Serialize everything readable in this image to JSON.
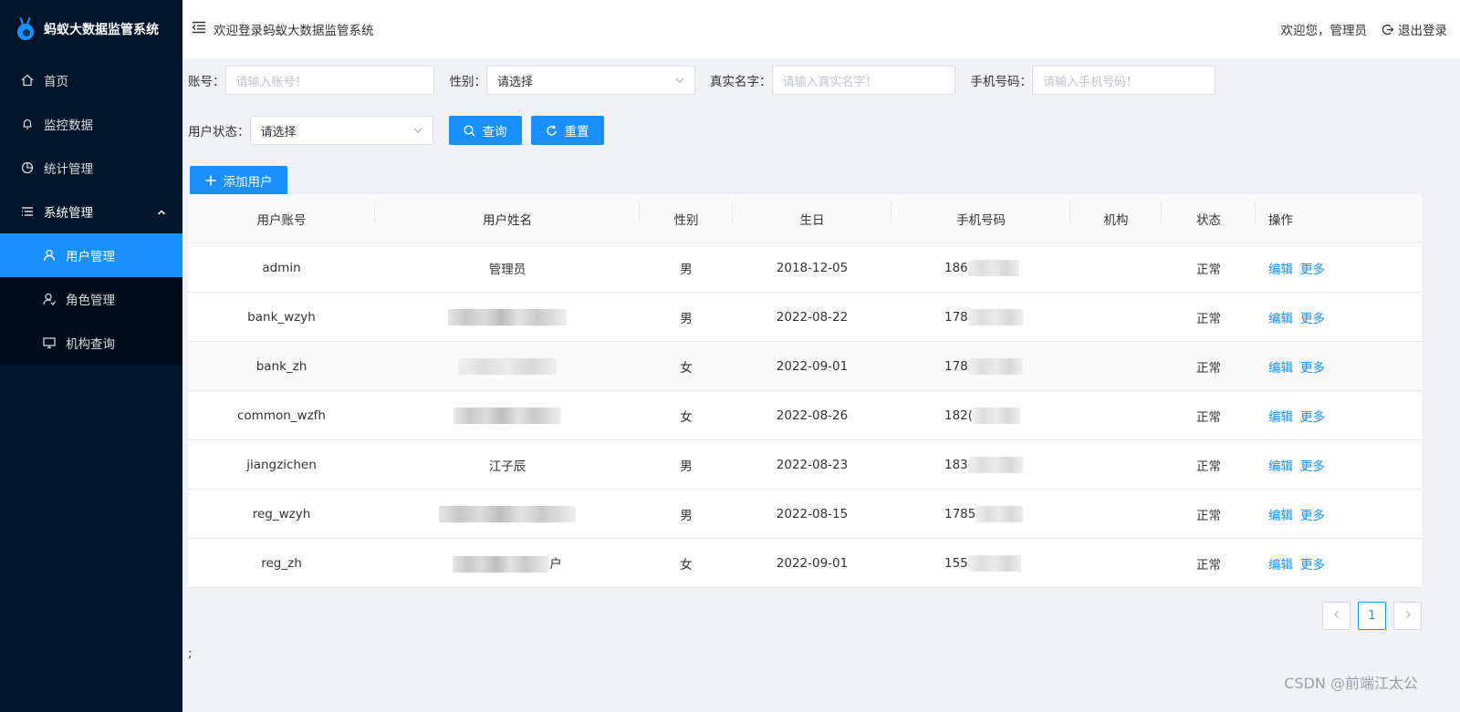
{
  "app": {
    "title": "蚂蚁大数据监管系统"
  },
  "sidebar": {
    "items": [
      {
        "label": "首页"
      },
      {
        "label": "监控数据"
      },
      {
        "label": "统计管理"
      },
      {
        "label": "系统管理"
      }
    ],
    "sub": [
      {
        "label": "用户管理"
      },
      {
        "label": "角色管理"
      },
      {
        "label": "机构查询"
      }
    ]
  },
  "header": {
    "welcome": "欢迎登录蚂蚁大数据监管系统",
    "greeting": "欢迎您，管理员",
    "logout": "退出登录"
  },
  "filters": {
    "account_label": "账号：",
    "account_placeholder": "请输入账号！",
    "gender_label": "性别：",
    "gender_value": "请选择",
    "realname_label": "真实名字：",
    "realname_placeholder": "请输入真实名字！",
    "phone_label": "手机号码：",
    "phone_placeholder": "请输入手机号码！",
    "status_label": "用户状态：",
    "status_value": "请选择",
    "search_button": "查询",
    "reset_button": "重置",
    "add_button": "添加用户"
  },
  "table": {
    "columns": [
      "用户账号",
      "用户姓名",
      "性别",
      "生日",
      "手机号码",
      "机构",
      "状态",
      "操作"
    ],
    "rows": [
      {
        "account": "admin",
        "name": "管理员",
        "gender": "男",
        "birthday": "2018-12-05",
        "phone": "186",
        "status": "正常"
      },
      {
        "account": "bank_wzyh",
        "name": "",
        "gender": "男",
        "birthday": "2022-08-22",
        "phone": "178",
        "status": "正常"
      },
      {
        "account": "bank_zh",
        "name": "",
        "gender": "女",
        "birthday": "2022-09-01",
        "phone": "178",
        "status": "正常"
      },
      {
        "account": "common_wzfh",
        "name": "",
        "gender": "女",
        "birthday": "2022-08-26",
        "phone": "182(",
        "status": "正常"
      },
      {
        "account": "jiangzichen",
        "name": "江子辰",
        "gender": "男",
        "birthday": "2022-08-23",
        "phone": "183",
        "status": "正常"
      },
      {
        "account": "reg_wzyh",
        "name": "",
        "gender": "男",
        "birthday": "2022-08-15",
        "phone": "1785",
        "status": "正常"
      },
      {
        "account": "reg_zh",
        "name": "户",
        "gender": "女",
        "birthday": "2022-09-01",
        "phone": "155",
        "status": "正常"
      }
    ],
    "edit_label": "编辑",
    "more_label": "更多"
  },
  "pagination": {
    "current": "1"
  },
  "footer": {
    "semicolon": ";",
    "watermark": "CSDN @前端江太公"
  }
}
